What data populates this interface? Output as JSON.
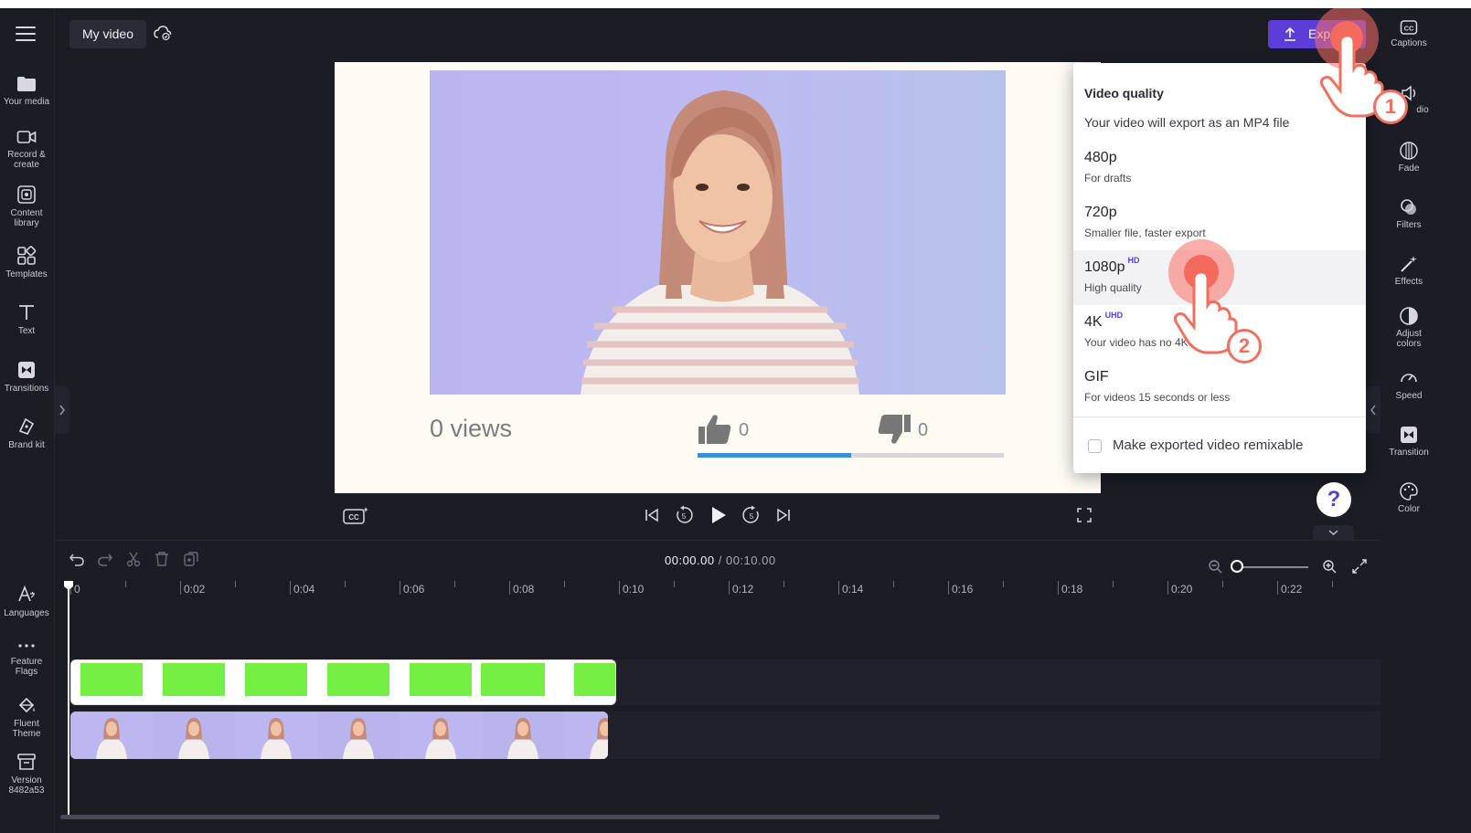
{
  "header": {
    "project_title": "My video",
    "export_label": "Export"
  },
  "left_sidebar": {
    "items": [
      {
        "label": "Your media",
        "icon": "folder-icon"
      },
      {
        "label": "Record &\ncreate",
        "icon": "video-camera-icon"
      },
      {
        "label": "Content\nlibrary",
        "icon": "content-library-icon"
      },
      {
        "label": "Templates",
        "icon": "templates-icon"
      },
      {
        "label": "Text",
        "icon": "text-icon"
      },
      {
        "label": "Transitions",
        "icon": "transitions-icon"
      },
      {
        "label": "Brand kit",
        "icon": "brand-kit-icon"
      }
    ],
    "bottom_items": [
      {
        "label": "Languages",
        "icon": "languages-icon"
      },
      {
        "label": "Feature\nFlags",
        "icon": "more-dots-icon"
      },
      {
        "label": "Fluent\nTheme",
        "icon": "paint-bucket-icon"
      },
      {
        "label": "Version\n8482a53",
        "icon": "archive-icon"
      }
    ]
  },
  "right_sidebar": {
    "items": [
      {
        "label": "Captions",
        "icon": "captions-icon"
      },
      {
        "label": "dio",
        "icon": "audio-icon"
      },
      {
        "label": "Fade",
        "icon": "fade-icon"
      },
      {
        "label": "Filters",
        "icon": "filters-icon"
      },
      {
        "label": "Effects",
        "icon": "effects-wand-icon"
      },
      {
        "label": "Adjust\ncolors",
        "icon": "adjust-colors-icon"
      },
      {
        "label": "Speed",
        "icon": "speed-icon"
      },
      {
        "label": "Transition",
        "icon": "transition-icon"
      },
      {
        "label": "Color",
        "icon": "color-palette-icon"
      }
    ]
  },
  "preview": {
    "views": "0 views",
    "likes": "0",
    "dislikes": "0",
    "like_ratio": 0.5
  },
  "export_menu": {
    "title": "Video quality",
    "subtitle": "Your video will export as an MP4 file",
    "options": [
      {
        "name": "480p",
        "badge": "",
        "desc": "For drafts"
      },
      {
        "name": "720p",
        "badge": "",
        "desc": "Smaller file, faster export"
      },
      {
        "name": "1080p",
        "badge": "HD",
        "desc": "High quality"
      },
      {
        "name": "4K",
        "badge": "UHD",
        "desc": "Your video has no 4K m"
      },
      {
        "name": "GIF",
        "badge": "",
        "desc": "For videos 15 seconds or less"
      }
    ],
    "selected_index": 2,
    "remix_label": "Make exported video remixable",
    "remix_checked": false
  },
  "help": {
    "label": "?"
  },
  "timeline": {
    "current_time": "00:00.00",
    "total_time": "/ 00:10.00",
    "ruler_labels": [
      "0",
      "0:02",
      "0:04",
      "0:06",
      "0:08",
      "0:10",
      "0:12",
      "0:14",
      "0:16",
      "0:18",
      "0:20",
      "0:22"
    ]
  },
  "tutorial": {
    "step1": "1",
    "step2": "2"
  },
  "colors": {
    "accent": "#5b3ed8",
    "background": "#1b1c24",
    "tap_highlight": "#f36a5e",
    "green_screen": "#74ef43"
  }
}
